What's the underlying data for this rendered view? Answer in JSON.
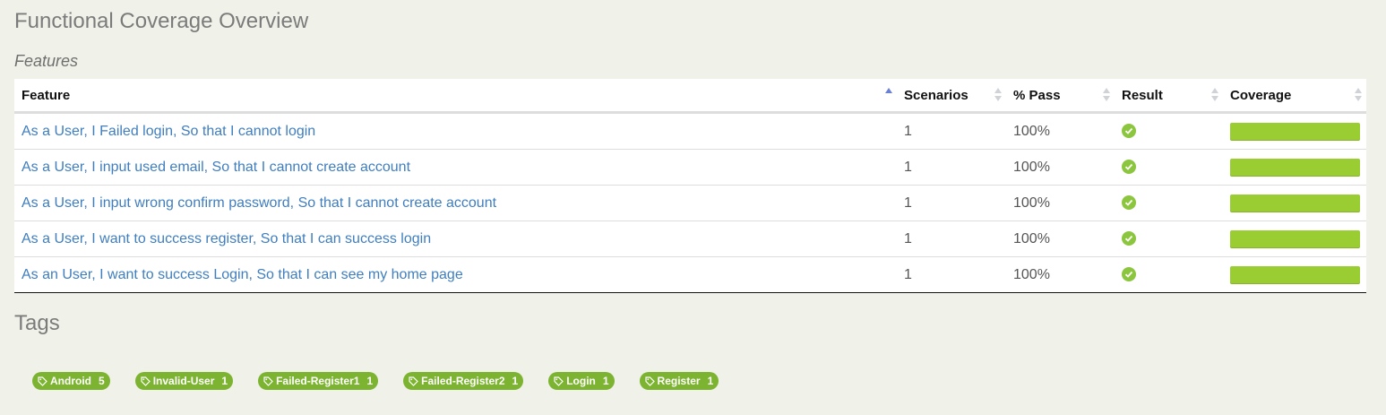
{
  "page": {
    "title": "Functional Coverage Overview",
    "features_caption": "Features",
    "tags_title": "Tags"
  },
  "table": {
    "columns": [
      "Feature",
      "Scenarios",
      "% Pass",
      "Result",
      "Coverage"
    ],
    "sorted_column": "Feature",
    "sort_direction": "ascending",
    "rows": [
      {
        "feature": "As a User, I Failed login, So that I cannot login",
        "scenarios": "1",
        "pass": "100%",
        "result": "passed",
        "coverage": 1.0
      },
      {
        "feature": "As a User, I input used email, So that I cannot create account",
        "scenarios": "1",
        "pass": "100%",
        "result": "passed",
        "coverage": 1.0
      },
      {
        "feature": "As a User, I input wrong confirm password, So that I cannot create account",
        "scenarios": "1",
        "pass": "100%",
        "result": "passed",
        "coverage": 1.0
      },
      {
        "feature": "As a User, I want to success register, So that I can success login",
        "scenarios": "1",
        "pass": "100%",
        "result": "passed",
        "coverage": 1.0
      },
      {
        "feature": "As an User, I want to success Login, So that I can see my home page",
        "scenarios": "1",
        "pass": "100%",
        "result": "passed",
        "coverage": 1.0
      }
    ]
  },
  "tags": [
    {
      "name": "Android",
      "count": "5"
    },
    {
      "name": "Invalid-User",
      "count": "1"
    },
    {
      "name": "Failed-Register1",
      "count": "1"
    },
    {
      "name": "Failed-Register2",
      "count": "1"
    },
    {
      "name": "Login",
      "count": "1"
    },
    {
      "name": "Register",
      "count": "1"
    }
  ],
  "colors": {
    "background": "#f0f1e8",
    "link": "#3f7ebf",
    "pass": "#8cc63f",
    "coverage": "#9acd32",
    "tag": "#7cb330",
    "sort_active": "#6b7fd7"
  },
  "icons": {
    "result": "check-circle-icon",
    "tag": "tag-icon",
    "sort": "sort-arrows-icon"
  }
}
